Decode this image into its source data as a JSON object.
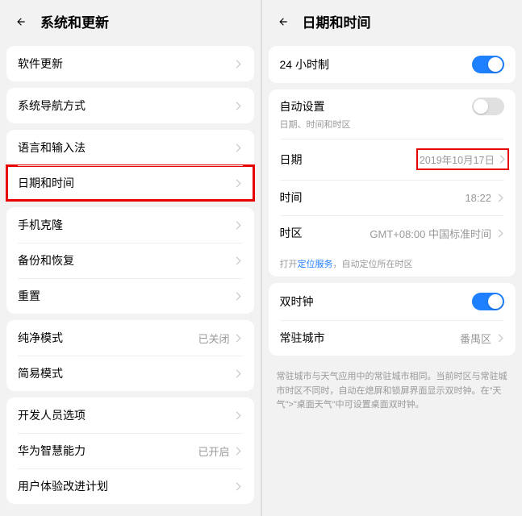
{
  "left": {
    "title": "系统和更新",
    "groups": [
      {
        "rows": [
          {
            "label": "软件更新",
            "chevron": true
          }
        ]
      },
      {
        "rows": [
          {
            "label": "系统导航方式",
            "chevron": true
          }
        ]
      },
      {
        "rows": [
          {
            "label": "语言和输入法",
            "chevron": true
          },
          {
            "label": "日期和时间",
            "chevron": true,
            "highlight": true
          }
        ]
      },
      {
        "rows": [
          {
            "label": "手机克隆",
            "chevron": true
          },
          {
            "label": "备份和恢复",
            "chevron": true
          },
          {
            "label": "重置",
            "chevron": true
          }
        ]
      },
      {
        "rows": [
          {
            "label": "纯净模式",
            "value": "已关闭",
            "chevron": true
          },
          {
            "label": "简易模式",
            "chevron": true
          }
        ]
      },
      {
        "rows": [
          {
            "label": "开发人员选项",
            "chevron": true
          },
          {
            "label": "华为智慧能力",
            "value": "已开启",
            "chevron": true
          },
          {
            "label": "用户体验改进计划",
            "chevron": true
          }
        ]
      }
    ]
  },
  "right": {
    "title": "日期和时间",
    "group1": {
      "row24h": {
        "label": "24 小时制",
        "toggle": "on"
      }
    },
    "group2": {
      "auto": {
        "label": "自动设置",
        "sub": "日期、时间和时区",
        "toggle": "off"
      },
      "date": {
        "label": "日期",
        "value": "2019年10月17日",
        "chevron": true,
        "highlightValue": true
      },
      "time": {
        "label": "时间",
        "value": "18:22",
        "chevron": true
      },
      "tz": {
        "label": "时区",
        "value": "GMT+08:00 中国标准时间",
        "chevron": true
      },
      "hint": {
        "prefix": "打开",
        "link": "定位服务",
        "suffix": "，自动定位所在时区"
      }
    },
    "group3": {
      "dual": {
        "label": "双时钟",
        "toggle": "on"
      },
      "city": {
        "label": "常驻城市",
        "value": "番禺区",
        "chevron": true
      }
    },
    "desc": "常驻城市与天气应用中的常驻城市相同。当前时区与常驻城市时区不同时，自动在熄屏和锁屏界面显示双时钟。在\"天气\">\"桌面天气\"中可设置桌面双时钟。"
  }
}
